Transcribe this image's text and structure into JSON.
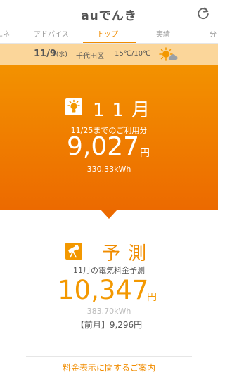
{
  "header": {
    "title": "auでんき"
  },
  "tabs": [
    {
      "label": "エネ"
    },
    {
      "label": "アドバイス"
    },
    {
      "label": "トップ",
      "active": true
    },
    {
      "label": "実績"
    },
    {
      "label": "分"
    }
  ],
  "weather": {
    "date": "11/9",
    "weekday": "(水)",
    "area": "千代田区",
    "temperature": "15℃/10℃",
    "icon": "sun-cloud-icon"
  },
  "current": {
    "icon": "lightbulb-icon",
    "month": "11月",
    "period": "11/25までのご利用分",
    "amount": "9,027",
    "unit": "円",
    "usage": "330.33kWh"
  },
  "forecast": {
    "icon": "telescope-icon",
    "label": "予測",
    "subtitle": "11月の電気料金予測",
    "amount": "10,347",
    "unit": "円",
    "usage": "383.70kWh",
    "previous": "【前月】9,296円"
  },
  "footer": {
    "link": "料金表示に関するご案内"
  },
  "colors": {
    "accent": "#f08c00",
    "gradient_top": "#f39200",
    "gradient_bottom": "#ec6a00",
    "weather_bar": "#fbd69a"
  }
}
